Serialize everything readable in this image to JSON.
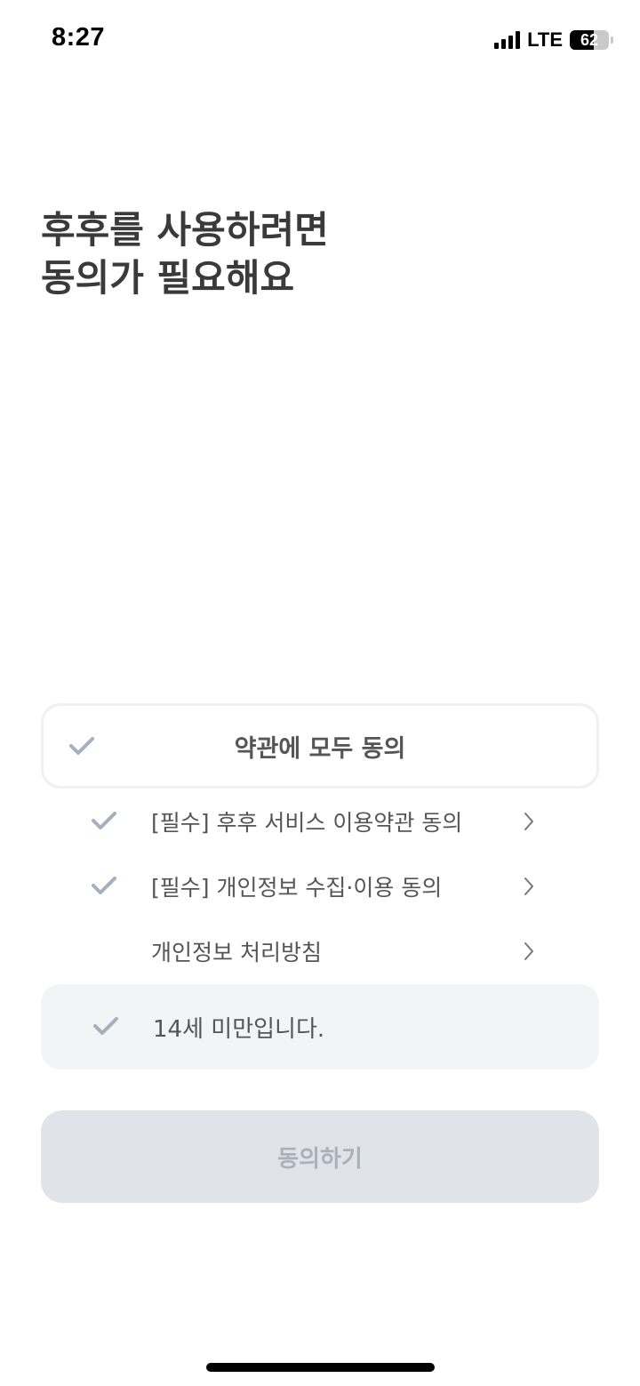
{
  "status_bar": {
    "time": "8:27",
    "network": "LTE",
    "battery": "62",
    "battery_level": 0.62
  },
  "title": "후후를 사용하려면\n동의가 필요해요",
  "agree_all": {
    "label": "약관에 모두 동의",
    "icon": "check-icon"
  },
  "terms": [
    {
      "label": "[필수] 후후 서비스 이용약관 동의",
      "checked": true,
      "icon": "chevron-right-icon"
    },
    {
      "label": "[필수] 개인정보 수집·이용 동의",
      "checked": true,
      "icon": "chevron-right-icon"
    },
    {
      "label": "개인정보 처리방침",
      "checked": false,
      "icon": "chevron-right-icon"
    }
  ],
  "age_option": {
    "label": "14세 미만입니다."
  },
  "agree_button": {
    "label": "동의하기"
  },
  "colors": {
    "check": "#a3b0bd",
    "button_bg": "#e0e3e7",
    "button_text": "#a9b2bc",
    "box_bg": "#f2f4f6"
  }
}
